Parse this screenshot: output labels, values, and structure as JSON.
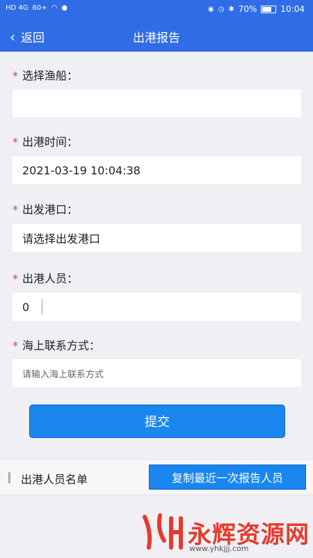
{
  "status": {
    "left_icons": [
      "HD 4G",
      "60+",
      "wifi",
      "eye",
      "msg"
    ],
    "battery": "70%",
    "time": "10:04",
    "battery_level": 0.7
  },
  "nav": {
    "back_label": "返回",
    "title": "出港报告"
  },
  "form": {
    "boat": {
      "label": "选择渔船：",
      "value": ""
    },
    "time": {
      "label": "出港时间：",
      "value": "2021-03-19 10:04:38"
    },
    "port": {
      "label": "出发港口：",
      "value": "请选择出发港口"
    },
    "crew": {
      "label": "出港人员：",
      "value": "0"
    },
    "contact": {
      "label": "海上联系方式：",
      "placeholder": "请输入海上联系方式"
    },
    "required_mark": "*"
  },
  "submit_label": "提交",
  "crew_section": {
    "title": "出港人员名单",
    "copy_button": "复制最近一次报告人员"
  },
  "watermark": {
    "text": "永辉资源网",
    "url": "www.yhkjjj.com"
  }
}
